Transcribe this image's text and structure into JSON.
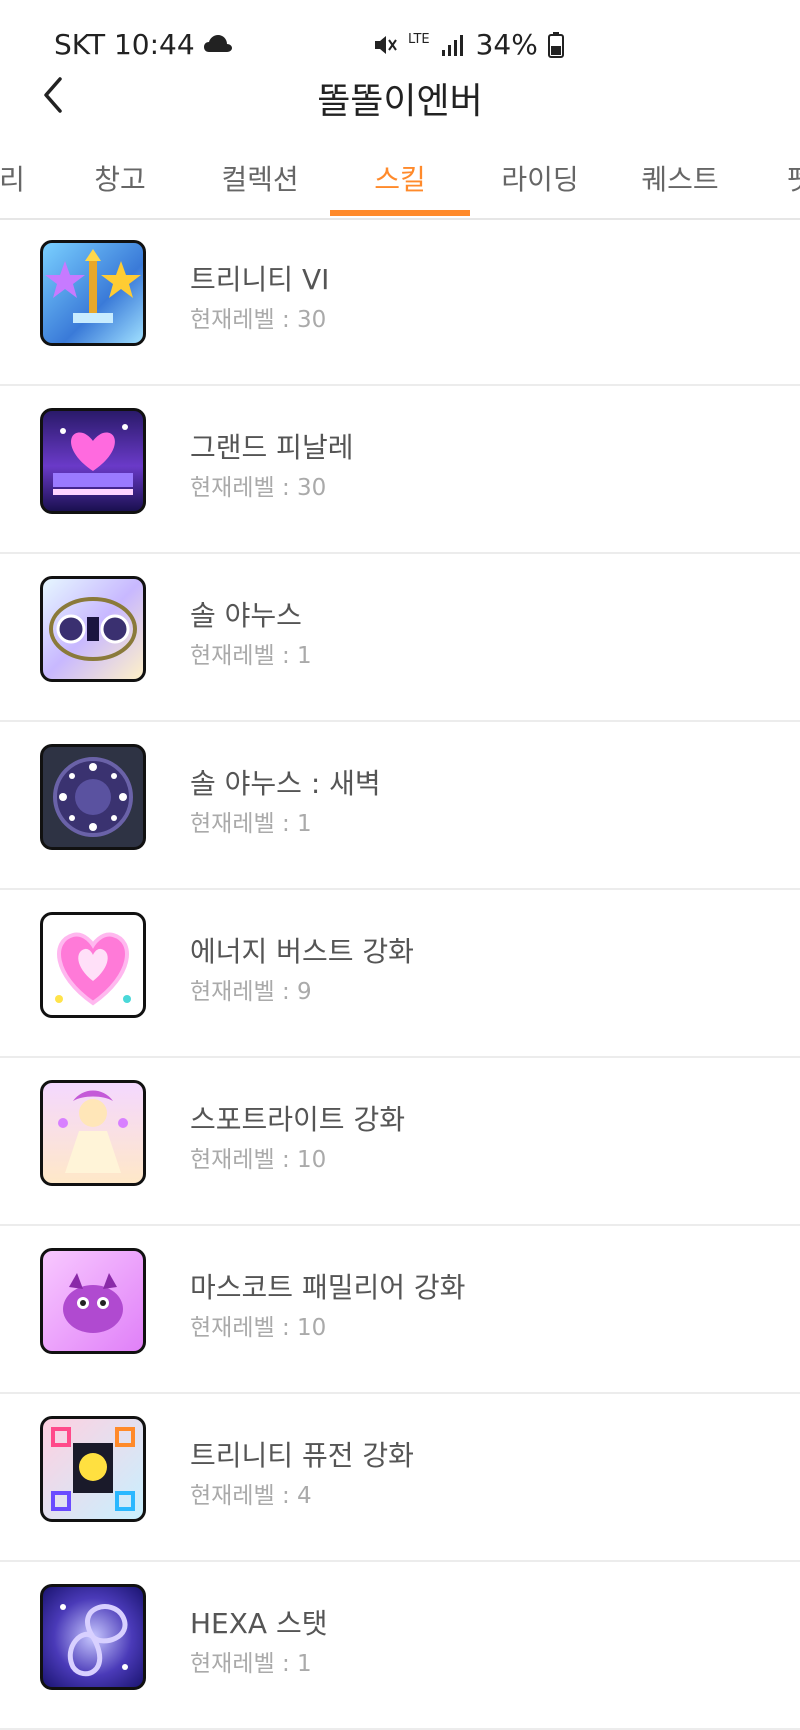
{
  "status": {
    "carrier_time": "SKT 10:44",
    "battery": "34%",
    "network": "LTE"
  },
  "header": {
    "title": "똘똘이엔버"
  },
  "tabs": [
    {
      "label": "리"
    },
    {
      "label": "창고"
    },
    {
      "label": "컬렉션"
    },
    {
      "label": "스킬"
    },
    {
      "label": "라이딩"
    },
    {
      "label": "퀘스트"
    },
    {
      "label": "펫"
    }
  ],
  "level_prefix": "현재레벨 : ",
  "skills": [
    {
      "name": "트리니티 VI",
      "level": "현재레벨 : 30"
    },
    {
      "name": "그랜드 피날레",
      "level": "현재레벨 : 30"
    },
    {
      "name": "솔 야누스",
      "level": "현재레벨 : 1"
    },
    {
      "name": "솔 야누스 : 새벽",
      "level": "현재레벨 : 1"
    },
    {
      "name": "에너지 버스트 강화",
      "level": "현재레벨 : 9"
    },
    {
      "name": "스포트라이트 강화",
      "level": "현재레벨 : 10"
    },
    {
      "name": "마스코트 패밀리어 강화",
      "level": "현재레벨 : 10"
    },
    {
      "name": "트리니티 퓨전 강화",
      "level": "현재레벨 : 4"
    },
    {
      "name": "HEXA 스탯",
      "level": "현재레벨 : 1"
    }
  ],
  "colors": {
    "accent": "#ff8a2b"
  }
}
